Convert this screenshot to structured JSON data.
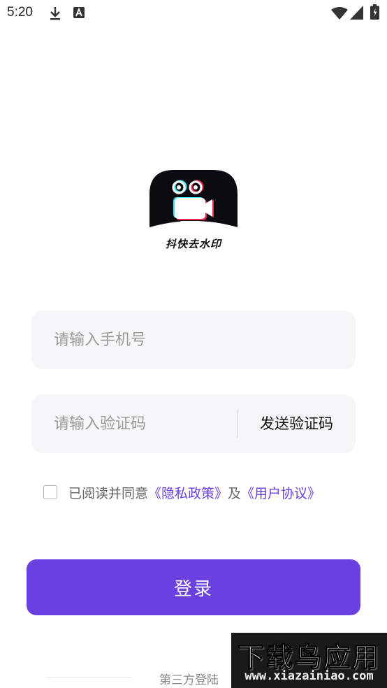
{
  "status_bar": {
    "time": "5:20",
    "icons_left": [
      "download-icon",
      "font-a-icon"
    ],
    "icons_right": [
      "wifi-icon",
      "signal-icon",
      "battery-icon"
    ]
  },
  "logo": {
    "caption": "抖快去水印",
    "background": "#0c0c10",
    "accent_cyan": "#35e6f0",
    "accent_red": "#f02a55"
  },
  "form": {
    "phone_placeholder": "请输入手机号",
    "code_placeholder": "请输入验证码",
    "send_code_label": "发送验证码",
    "agreement": {
      "checked": false,
      "prefix": "已阅读并同意",
      "privacy_link": "《隐私政策》",
      "conjunction": "及",
      "terms_link": "《用户协议》"
    },
    "login_label": "登录"
  },
  "third_party": {
    "label": "第三方登陆"
  },
  "watermark": {
    "title": "下载鸟应用",
    "url": "www.xiazainiao.com"
  },
  "colors": {
    "accent": "#6a40e0",
    "field_background": "#f6f6f8",
    "placeholder": "#9a9a9a"
  }
}
